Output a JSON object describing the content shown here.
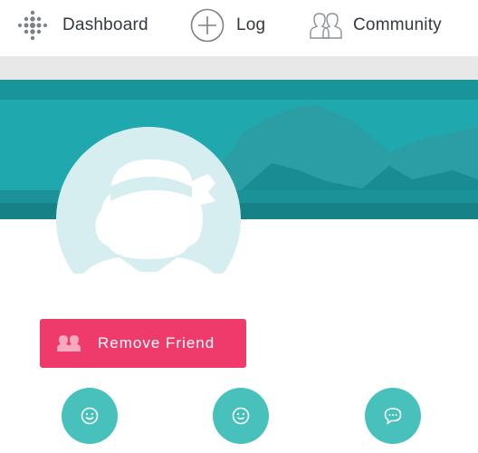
{
  "nav": {
    "items": [
      {
        "label": "Dashboard",
        "icon": "fitbit-dots-icon"
      },
      {
        "label": "Log",
        "icon": "plus-circle-icon"
      },
      {
        "label": "Community",
        "icon": "people-icon"
      }
    ]
  },
  "profile": {
    "avatar_icon": "default-avatar-icon",
    "banner": "mountain-banner"
  },
  "actions": {
    "remove_friend_label": "Remove Friend",
    "remove_friend_icon": "people-icon",
    "circle_buttons": [
      {
        "icon": "smiley-icon"
      },
      {
        "icon": "smiley-icon"
      },
      {
        "icon": "chat-bubble-icon"
      }
    ]
  },
  "colors": {
    "accent_teal": "#48c1bd",
    "banner_teal": "#1fa8ad",
    "remove_pink": "#ee3b6b",
    "avatar_fill": "#d6eef0"
  }
}
